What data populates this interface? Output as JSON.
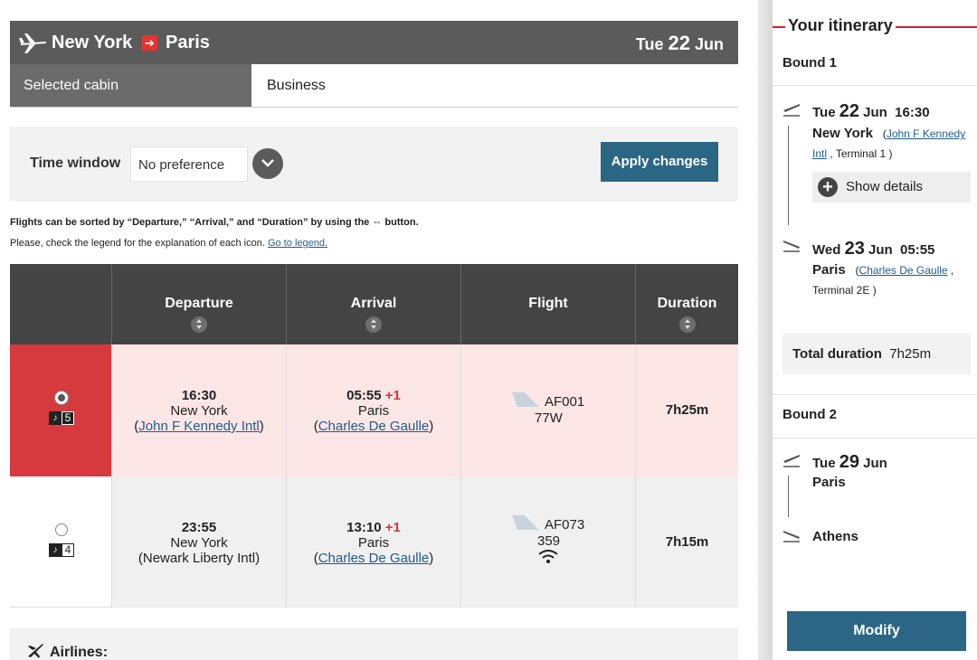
{
  "header": {
    "from": "New York",
    "to": "Paris",
    "date_weekday": "Tue",
    "date_day": "22",
    "date_month": "Jun"
  },
  "cabin": {
    "label": "Selected cabin",
    "value": "Business"
  },
  "filter": {
    "time_window_label": "Time window",
    "time_window_value": "No preference",
    "apply_label": "Apply changes"
  },
  "notes": {
    "sort_note": "Flights can be sorted by “Departure,” “Arrival,” and “Duration” by using the ⇔ button.",
    "legend_note": "Please, check the legend for the explanation of each icon.",
    "legend_link": "Go to legend."
  },
  "table": {
    "headers": {
      "departure": "Departure",
      "arrival": "Arrival",
      "flight": "Flight",
      "duration": "Duration"
    },
    "rows": [
      {
        "selected": true,
        "seats": "5",
        "dep_time": "16:30",
        "dep_city": "New York",
        "dep_airport": "John F Kennedy Intl",
        "arr_time": "05:55",
        "arr_plus": "+1",
        "arr_city": "Paris",
        "arr_airport": "Charles De Gaulle",
        "flight_no": "AF001",
        "aircraft": "77W",
        "duration": "7h25m"
      },
      {
        "selected": false,
        "seats": "4",
        "dep_time": "23:55",
        "dep_city": "New York",
        "dep_airport": "(Newark Liberty Intl)",
        "arr_time": "13:10",
        "arr_plus": "+1",
        "arr_city": "Paris",
        "arr_airport": "Charles De Gaulle",
        "flight_no": "AF073",
        "aircraft": "359",
        "duration": "7h15m"
      }
    ]
  },
  "airlines_label": "Airlines:",
  "itinerary": {
    "title": "Your itinerary",
    "bound1": {
      "label": "Bound 1",
      "dep_weekday": "Tue",
      "dep_day": "22",
      "dep_month": "Jun",
      "dep_time": "16:30",
      "dep_city": "New York",
      "dep_airport": "John F Kennedy Intl",
      "dep_terminal": "Terminal 1",
      "show_details": "Show details",
      "arr_weekday": "Wed",
      "arr_day": "23",
      "arr_month": "Jun",
      "arr_time": "05:55",
      "arr_city": "Paris",
      "arr_airport": "Charles De Gaulle",
      "arr_terminal": "Terminal 2E",
      "total_label": "Total duration",
      "total_value": "7h25m"
    },
    "bound2": {
      "label": "Bound 2",
      "dep_weekday": "Tue",
      "dep_day": "29",
      "dep_month": "Jun",
      "dep_city": "Paris",
      "arr_city": "Athens"
    },
    "modify_label": "Modify"
  },
  "colors": {
    "accent_red": "#d2232a",
    "button_blue": "#2b6685",
    "header_gray": "#5b5b5b"
  }
}
